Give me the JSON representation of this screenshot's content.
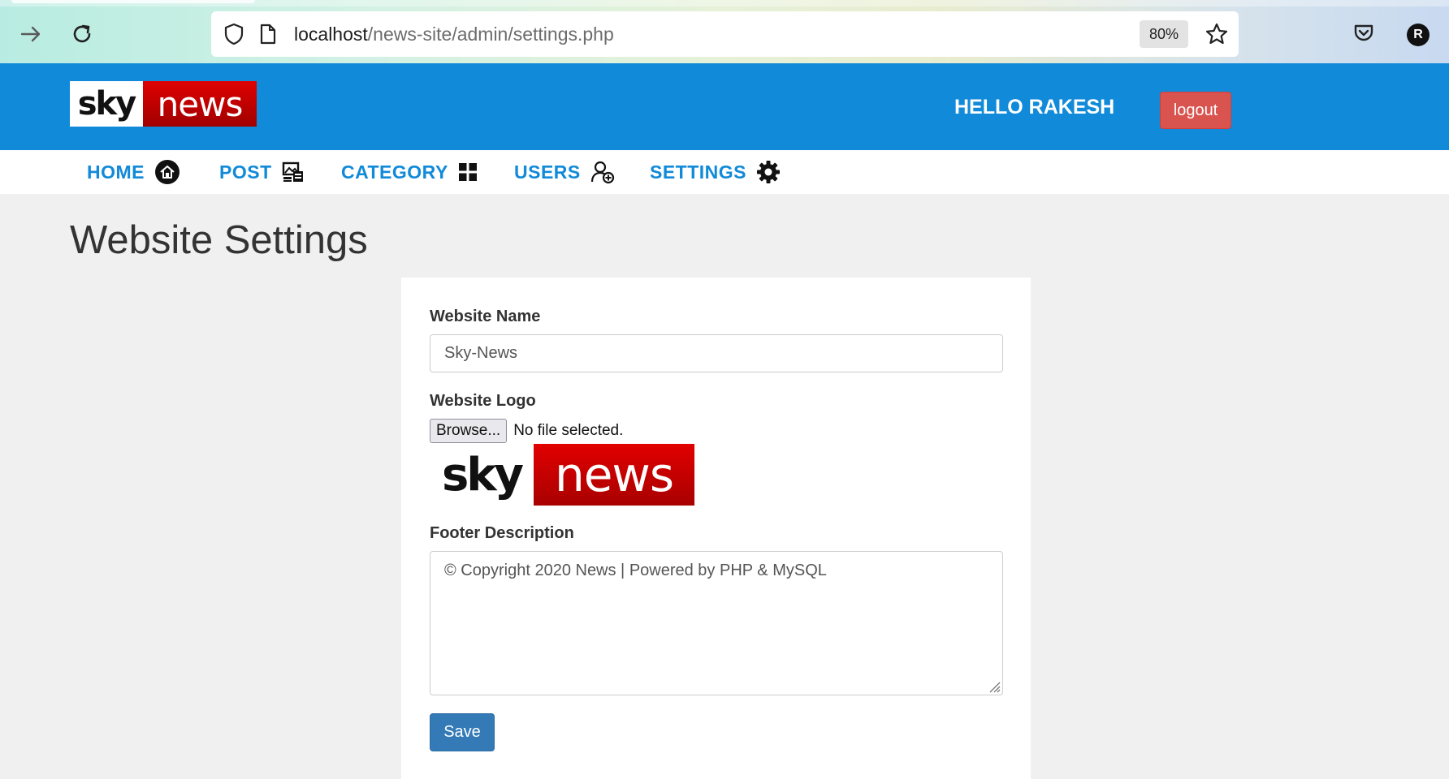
{
  "browser": {
    "url_host": "localhost",
    "url_path": "/news-site/admin/settings.php",
    "zoom": "80%",
    "profile_initial": "R"
  },
  "header": {
    "logo_sky": "sky",
    "logo_news": "news",
    "greeting": "HELLO RAKESH",
    "logout_label": "logout"
  },
  "menu": {
    "items": [
      {
        "label": "HOME",
        "icon": "home-icon"
      },
      {
        "label": "POST",
        "icon": "post-icon"
      },
      {
        "label": "CATEGORY",
        "icon": "grid-icon"
      },
      {
        "label": "USERS",
        "icon": "add-user-icon"
      },
      {
        "label": "SETTINGS",
        "icon": "gear-icon"
      }
    ]
  },
  "page": {
    "title": "Website Settings"
  },
  "form": {
    "website_name_label": "Website Name",
    "website_name_value": "Sky-News",
    "website_logo_label": "Website Logo",
    "browse_label": "Browse...",
    "no_file_text": "No file selected.",
    "logo_preview_sky": "sky",
    "logo_preview_news": "news",
    "footer_label": "Footer Description",
    "footer_value": "© Copyright 2020 News | Powered by PHP & MySQL",
    "save_label": "Save"
  },
  "colors": {
    "header_blue": "#108ad9",
    "logout_red": "#d9534f",
    "save_blue": "#337ab7",
    "brand_red": "#c40000"
  }
}
